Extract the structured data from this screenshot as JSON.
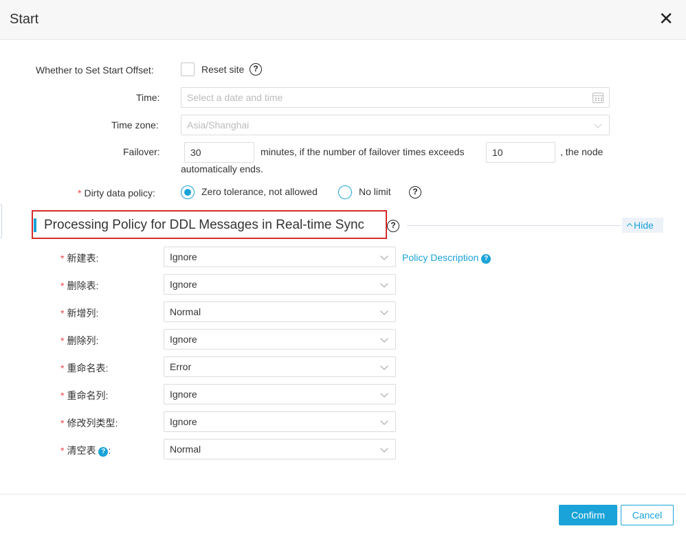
{
  "dialog": {
    "title": "Start",
    "close_label": "✕"
  },
  "form": {
    "start_offset": {
      "label": "Whether to Set Start Offset:",
      "checkbox_label": "Reset site",
      "help": "?"
    },
    "time": {
      "label": "Time:",
      "placeholder": "Select a date and time"
    },
    "time_zone": {
      "label": "Time zone:",
      "value": "Asia/Shanghai"
    },
    "failover": {
      "label": "Failover:",
      "minutes_value": "30",
      "middle_text": "minutes, if the number of failover times exceeds",
      "times_value": "10",
      "tail_text": ", the node",
      "wrap_text": "automatically ends."
    },
    "dirty_data_policy": {
      "required_mark": "*",
      "label": "Dirty data policy:",
      "options": [
        "Zero tolerance, not allowed",
        "No limit"
      ],
      "selected": "Zero tolerance, not allowed",
      "help": "?"
    }
  },
  "ddl_section": {
    "title": "Processing Policy for DDL Messages in Real-time Sync",
    "help": "?",
    "hide_label": "Hide",
    "policy_link": "Policy Description",
    "policy_help": "?",
    "rows": [
      {
        "required_mark": "*",
        "label": "新建表:",
        "value": "Ignore"
      },
      {
        "required_mark": "*",
        "label": "删除表:",
        "value": "Ignore"
      },
      {
        "required_mark": "*",
        "label": "新增列:",
        "value": "Normal"
      },
      {
        "required_mark": "*",
        "label": "删除列:",
        "value": "Ignore"
      },
      {
        "required_mark": "*",
        "label": "重命名表:",
        "value": "Error"
      },
      {
        "required_mark": "*",
        "label": "重命名列:",
        "value": "Ignore"
      },
      {
        "required_mark": "*",
        "label": "修改列类型:",
        "value": "Ignore"
      },
      {
        "required_mark": "*",
        "label": "清空表",
        "value": "Normal",
        "help": "?",
        "colon": ":"
      }
    ]
  },
  "footer": {
    "confirm_label": "Confirm",
    "cancel_label": "Cancel"
  },
  "colors": {
    "accent": "#1aa3d8",
    "highlight_border": "#d42a2a",
    "required": "#e44444"
  }
}
